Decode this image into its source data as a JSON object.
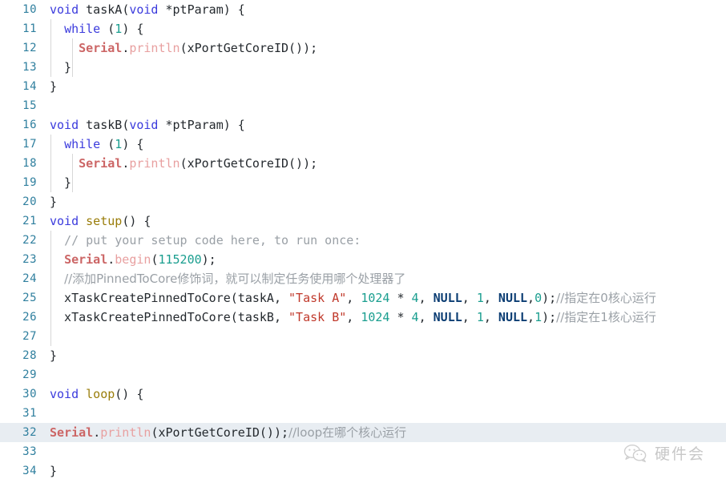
{
  "editor": {
    "language": "arduino-cpp",
    "first_line_number": 10,
    "colors": {
      "background": "#ffffff",
      "gutter_text": "#2f7f9e",
      "keyword": "#3b3bdd",
      "function_name": "#9a7d0a",
      "library": "#cc6666",
      "method": "#e8a0a0",
      "number": "#1a9e8f",
      "string": "#c0392b",
      "null_constant": "#0b3d73",
      "comment": "#9aa0a6",
      "selection": "#e8edf2",
      "indent_guide": "#d7d7d7"
    },
    "lines": [
      {
        "number": "10",
        "indent_guides": 0,
        "selected": false,
        "tokens": [
          {
            "t": "void",
            "c": "kw"
          },
          {
            "t": " ",
            "c": "punct"
          },
          {
            "t": "taskA",
            "c": "ident"
          },
          {
            "t": "(",
            "c": "punct"
          },
          {
            "t": "void",
            "c": "kw"
          },
          {
            "t": " *ptParam) {",
            "c": "punct"
          }
        ]
      },
      {
        "number": "11",
        "indent_guides": 1,
        "selected": false,
        "tokens": [
          {
            "t": "  ",
            "c": "punct"
          },
          {
            "t": "while",
            "c": "kw"
          },
          {
            "t": " (",
            "c": "punct"
          },
          {
            "t": "1",
            "c": "num"
          },
          {
            "t": ") {",
            "c": "punct"
          }
        ]
      },
      {
        "number": "12",
        "indent_guides": 2,
        "selected": false,
        "tokens": [
          {
            "t": "    ",
            "c": "punct"
          },
          {
            "t": "Serial",
            "c": "lib"
          },
          {
            "t": ".",
            "c": "punct"
          },
          {
            "t": "println",
            "c": "method"
          },
          {
            "t": "(xPortGetCoreID());",
            "c": "punct"
          }
        ]
      },
      {
        "number": "13",
        "indent_guides": 2,
        "selected": false,
        "tokens": [
          {
            "t": "  }",
            "c": "punct"
          }
        ]
      },
      {
        "number": "14",
        "indent_guides": 0,
        "selected": false,
        "tokens": [
          {
            "t": "}",
            "c": "punct"
          }
        ]
      },
      {
        "number": "15",
        "indent_guides": 0,
        "selected": false,
        "tokens": []
      },
      {
        "number": "16",
        "indent_guides": 0,
        "selected": false,
        "tokens": [
          {
            "t": "void",
            "c": "kw"
          },
          {
            "t": " ",
            "c": "punct"
          },
          {
            "t": "taskB",
            "c": "ident"
          },
          {
            "t": "(",
            "c": "punct"
          },
          {
            "t": "void",
            "c": "kw"
          },
          {
            "t": " *ptParam) {",
            "c": "punct"
          }
        ]
      },
      {
        "number": "17",
        "indent_guides": 1,
        "selected": false,
        "tokens": [
          {
            "t": "  ",
            "c": "punct"
          },
          {
            "t": "while",
            "c": "kw"
          },
          {
            "t": " (",
            "c": "punct"
          },
          {
            "t": "1",
            "c": "num"
          },
          {
            "t": ") {",
            "c": "punct"
          }
        ]
      },
      {
        "number": "18",
        "indent_guides": 2,
        "selected": false,
        "tokens": [
          {
            "t": "    ",
            "c": "punct"
          },
          {
            "t": "Serial",
            "c": "lib"
          },
          {
            "t": ".",
            "c": "punct"
          },
          {
            "t": "println",
            "c": "method"
          },
          {
            "t": "(xPortGetCoreID());",
            "c": "punct"
          }
        ]
      },
      {
        "number": "19",
        "indent_guides": 2,
        "selected": false,
        "tokens": [
          {
            "t": "  }",
            "c": "punct"
          }
        ]
      },
      {
        "number": "20",
        "indent_guides": 0,
        "selected": false,
        "tokens": [
          {
            "t": "}",
            "c": "punct"
          }
        ]
      },
      {
        "number": "21",
        "indent_guides": 0,
        "selected": false,
        "tokens": [
          {
            "t": "void",
            "c": "kw"
          },
          {
            "t": " ",
            "c": "punct"
          },
          {
            "t": "setup",
            "c": "fn"
          },
          {
            "t": "() {",
            "c": "punct"
          }
        ]
      },
      {
        "number": "22",
        "indent_guides": 1,
        "selected": false,
        "tokens": [
          {
            "t": "  ",
            "c": "punct"
          },
          {
            "t": "// put your setup code here, to run once:",
            "c": "cmt"
          }
        ]
      },
      {
        "number": "23",
        "indent_guides": 1,
        "selected": false,
        "tokens": [
          {
            "t": "  ",
            "c": "punct"
          },
          {
            "t": "Serial",
            "c": "lib"
          },
          {
            "t": ".",
            "c": "punct"
          },
          {
            "t": "begin",
            "c": "method"
          },
          {
            "t": "(",
            "c": "punct"
          },
          {
            "t": "115200",
            "c": "num"
          },
          {
            "t": ");",
            "c": "punct"
          }
        ]
      },
      {
        "number": "24",
        "indent_guides": 1,
        "selected": false,
        "tokens": [
          {
            "t": "  ",
            "c": "punct"
          },
          {
            "t": "//添加PinnedToCore修饰词，就可以制定任务使用哪个处理器了",
            "c": "cmt cn"
          }
        ]
      },
      {
        "number": "25",
        "indent_guides": 1,
        "selected": false,
        "tokens": [
          {
            "t": "  xTaskCreatePinnedToCore(taskA, ",
            "c": "punct"
          },
          {
            "t": "\"Task A\"",
            "c": "str"
          },
          {
            "t": ", ",
            "c": "punct"
          },
          {
            "t": "1024",
            "c": "num"
          },
          {
            "t": " * ",
            "c": "punct"
          },
          {
            "t": "4",
            "c": "num"
          },
          {
            "t": ", ",
            "c": "punct"
          },
          {
            "t": "NULL",
            "c": "null"
          },
          {
            "t": ", ",
            "c": "punct"
          },
          {
            "t": "1",
            "c": "num"
          },
          {
            "t": ", ",
            "c": "punct"
          },
          {
            "t": "NULL",
            "c": "null"
          },
          {
            "t": ",",
            "c": "punct"
          },
          {
            "t": "0",
            "c": "num"
          },
          {
            "t": ");",
            "c": "punct"
          },
          {
            "t": "//指定在0核心运行",
            "c": "cmt cn"
          }
        ]
      },
      {
        "number": "26",
        "indent_guides": 1,
        "selected": false,
        "tokens": [
          {
            "t": "  xTaskCreatePinnedToCore(taskB, ",
            "c": "punct"
          },
          {
            "t": "\"Task B\"",
            "c": "str"
          },
          {
            "t": ", ",
            "c": "punct"
          },
          {
            "t": "1024",
            "c": "num"
          },
          {
            "t": " * ",
            "c": "punct"
          },
          {
            "t": "4",
            "c": "num"
          },
          {
            "t": ", ",
            "c": "punct"
          },
          {
            "t": "NULL",
            "c": "null"
          },
          {
            "t": ", ",
            "c": "punct"
          },
          {
            "t": "1",
            "c": "num"
          },
          {
            "t": ", ",
            "c": "punct"
          },
          {
            "t": "NULL",
            "c": "null"
          },
          {
            "t": ",",
            "c": "punct"
          },
          {
            "t": "1",
            "c": "num"
          },
          {
            "t": ");",
            "c": "punct"
          },
          {
            "t": "//指定在1核心运行",
            "c": "cmt cn"
          }
        ]
      },
      {
        "number": "27",
        "indent_guides": 1,
        "selected": false,
        "tokens": []
      },
      {
        "number": "28",
        "indent_guides": 0,
        "selected": false,
        "tokens": [
          {
            "t": "}",
            "c": "punct"
          }
        ]
      },
      {
        "number": "29",
        "indent_guides": 0,
        "selected": false,
        "tokens": []
      },
      {
        "number": "30",
        "indent_guides": 0,
        "selected": false,
        "tokens": [
          {
            "t": "void",
            "c": "kw"
          },
          {
            "t": " ",
            "c": "punct"
          },
          {
            "t": "loop",
            "c": "fn"
          },
          {
            "t": "() {",
            "c": "punct"
          }
        ]
      },
      {
        "number": "31",
        "indent_guides": 0,
        "selected": false,
        "tokens": []
      },
      {
        "number": "32",
        "indent_guides": 0,
        "selected": true,
        "tokens": [
          {
            "t": "Serial",
            "c": "lib"
          },
          {
            "t": ".",
            "c": "punct"
          },
          {
            "t": "println",
            "c": "method"
          },
          {
            "t": "(xPortGetCoreID());",
            "c": "punct"
          },
          {
            "t": "//loop在哪个核心运行",
            "c": "cmt cn"
          }
        ]
      },
      {
        "number": "33",
        "indent_guides": 0,
        "selected": false,
        "tokens": []
      },
      {
        "number": "34",
        "indent_guides": 0,
        "selected": false,
        "tokens": [
          {
            "t": "}",
            "c": "punct"
          }
        ]
      }
    ]
  },
  "watermark": {
    "icon": "wechat-icon",
    "text": "硬件会"
  }
}
